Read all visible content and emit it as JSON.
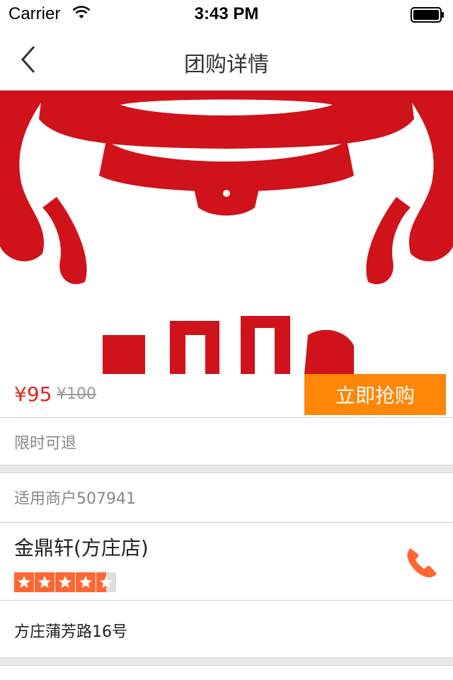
{
  "status_bar": {
    "carrier": "Carrier",
    "time": "3:43 PM"
  },
  "nav": {
    "title": "团购详情"
  },
  "deal": {
    "price": "¥95",
    "original_price": "¥100",
    "buy_label": "立即抢购",
    "refund_note": "限时可退"
  },
  "merchant": {
    "header": "适用商户507941",
    "name": "金鼎轩(方庄店)",
    "rating": 4.5,
    "rating_max": 5,
    "address": "方庄蒲芳路16号"
  },
  "colors": {
    "accent": "#fd8607",
    "price": "#e6231e",
    "star": "#ff6633",
    "logo": "#d0121b"
  },
  "icons": {
    "back": "chevron-left-icon",
    "phone": "phone-icon",
    "wifi": "wifi-icon",
    "battery": "battery-icon"
  }
}
